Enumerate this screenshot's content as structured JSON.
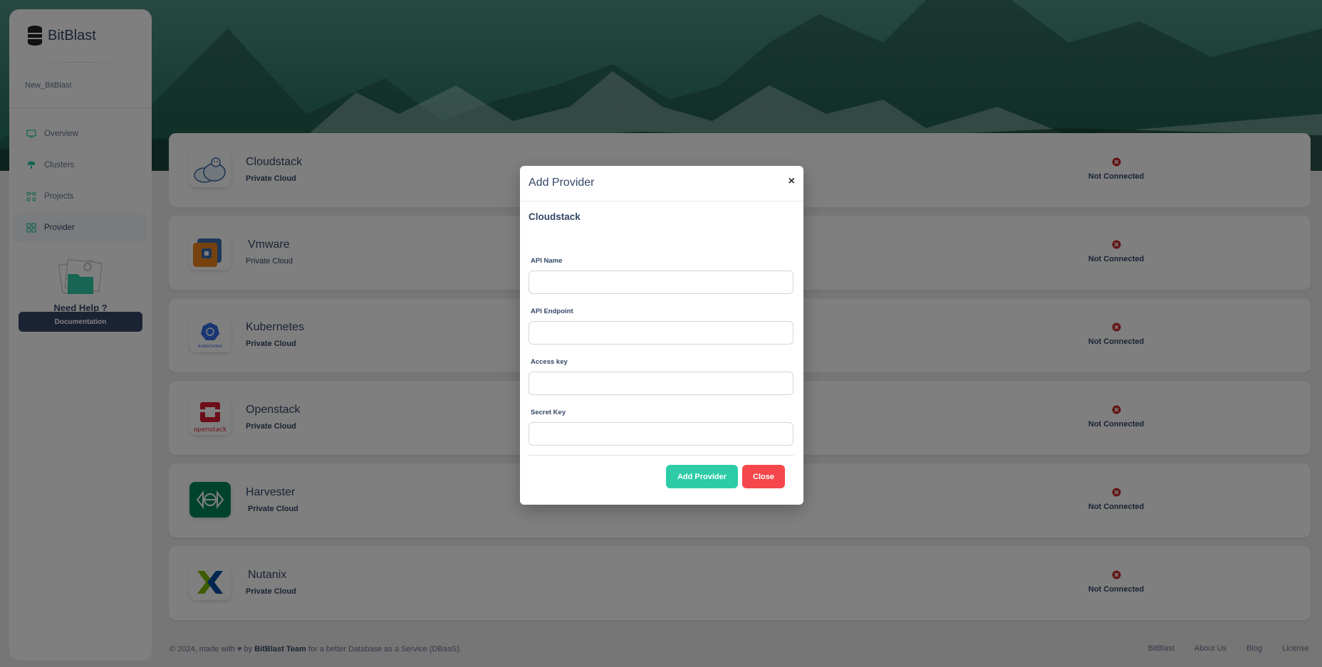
{
  "sidebar": {
    "brand": "BitBlast",
    "workspace": "New_BitBlast",
    "items": [
      {
        "label": "Overview",
        "icon": "monitor-icon"
      },
      {
        "label": "Clusters",
        "icon": "cluster-icon"
      },
      {
        "label": "Projects",
        "icon": "projects-icon"
      },
      {
        "label": "Provider",
        "icon": "provider-icon",
        "active": true
      }
    ],
    "help_title": "Need Help ?",
    "doc_button": "Documentation"
  },
  "providers": [
    {
      "name": "Cloudstack",
      "type": "Private Cloud",
      "status": "Not Connected",
      "logo": "cloudstack-logo"
    },
    {
      "name": "Vmware",
      "type": "Private Cloud",
      "status": "Not Connected",
      "logo": "vmware-logo"
    },
    {
      "name": "Kubernetes",
      "type": "Private Cloud",
      "status": "Not Connected",
      "logo": "kubernetes-logo"
    },
    {
      "name": "Openstack",
      "type": "Private Cloud",
      "status": "Not Connected",
      "logo": "openstack-logo"
    },
    {
      "name": "Harvester",
      "type": "Private Cloud",
      "status": "Not Connected",
      "logo": "harvester-logo"
    },
    {
      "name": "Nutanix",
      "type": "Private Cloud",
      "status": "Not Connected",
      "logo": "nutanix-logo"
    }
  ],
  "logo_text": {
    "kubernetes": "kubernetes",
    "openstack": "openstack"
  },
  "footer": {
    "prefix": "© 2024, made with",
    "by": "by",
    "team": "BitBlast Team",
    "suffix": "for a better Database as a Service (DBaaS).",
    "links": [
      "BitBlast",
      "About Us",
      "Blog",
      "License"
    ]
  },
  "modal": {
    "title": "Add Provider",
    "close_symbol": "×",
    "provider": "Cloudstack",
    "fields": [
      {
        "label": "API Name",
        "value": ""
      },
      {
        "label": "API Endpoint",
        "value": ""
      },
      {
        "label": "Access key",
        "value": ""
      },
      {
        "label": "Secret Key",
        "value": ""
      }
    ],
    "add_button": "Add Provider",
    "close_button": "Close"
  },
  "colors": {
    "primary_dark": "#344767",
    "accent_teal": "#2dcca7",
    "danger": "#f5474b",
    "status_error": "#c62828"
  }
}
